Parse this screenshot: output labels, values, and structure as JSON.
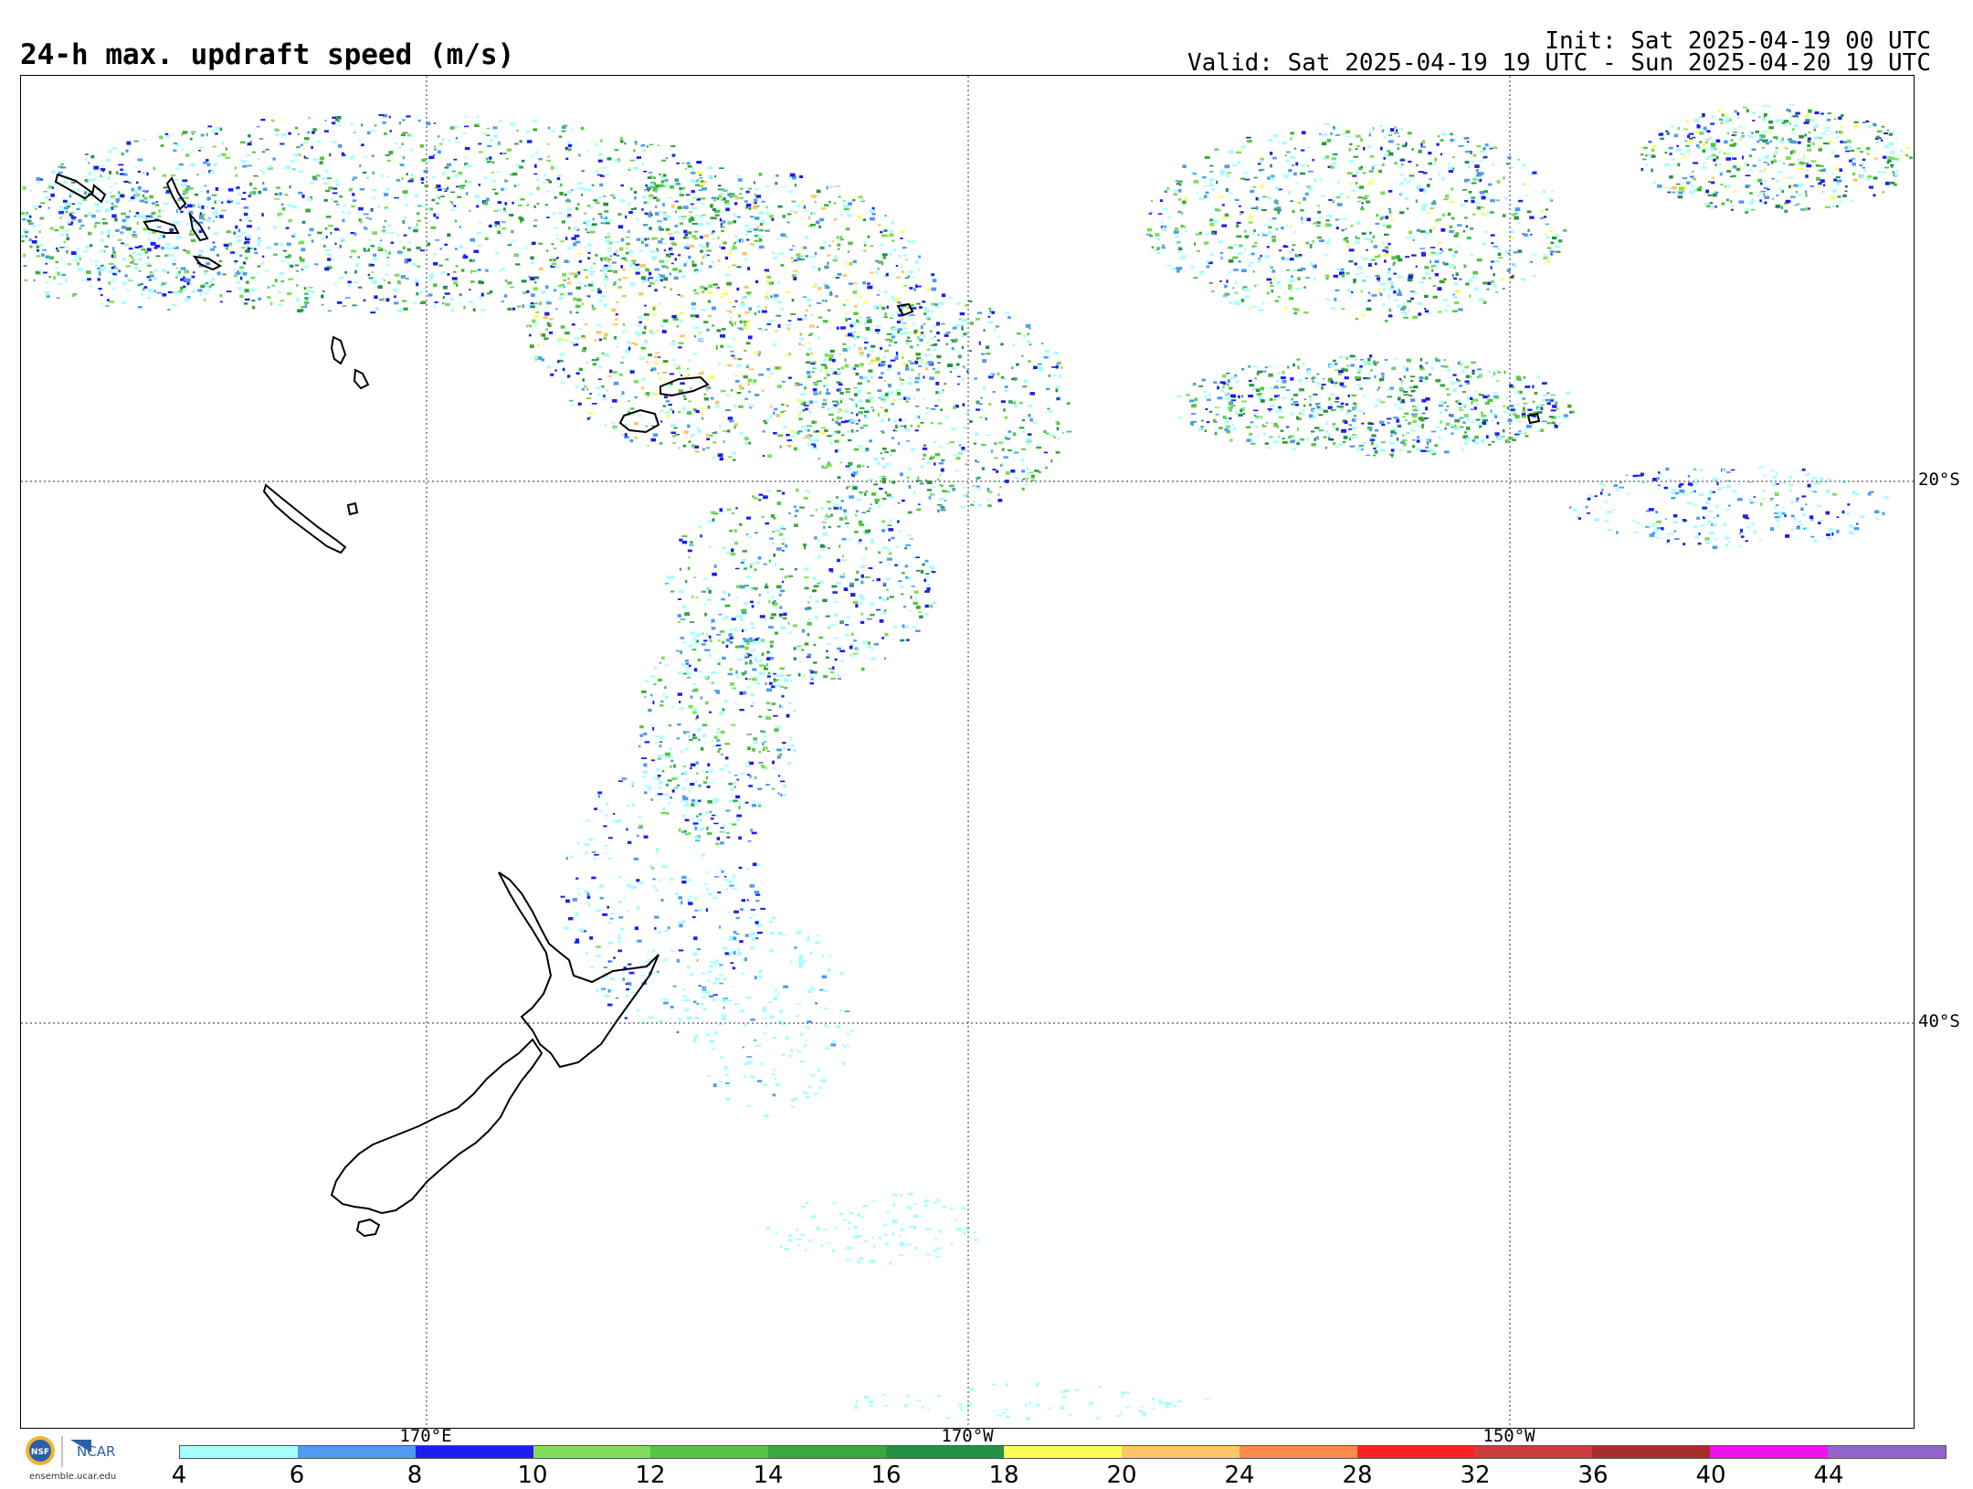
{
  "header": {
    "title": "24-h max. updraft speed (m/s)",
    "init": "Init: Sat 2025-04-19 00 UTC",
    "valid": "Valid: Sat 2025-04-19 19 UTC - Sun 2025-04-20 19 UTC"
  },
  "grid": {
    "lat_labels": [
      "20°S",
      "40°S"
    ],
    "lon_labels": [
      "170°E",
      "170°W",
      "150°W"
    ]
  },
  "map": {
    "field": "updraft speed",
    "landmasses": [
      "New Zealand North Island",
      "New Zealand South Island",
      "Stewart Island",
      "New Caledonia",
      "Vanuatu",
      "Fiji",
      "Tonga",
      "Solomon Islands"
    ]
  },
  "colorbar": {
    "ticks": [
      "4",
      "6",
      "8",
      "10",
      "12",
      "14",
      "16",
      "18",
      "20",
      "24",
      "28",
      "32",
      "36",
      "40",
      "44"
    ],
    "colors": [
      "#a6ffff",
      "#4d9cf2",
      "#1d1df2",
      "#7edc5a",
      "#54c544",
      "#38a83a",
      "#249245",
      "#fdfd5a",
      "#fec664",
      "#fd8a4a",
      "#fd2121",
      "#cc3c3c",
      "#a82c2c",
      "#ee12ee",
      "#9464cc"
    ]
  },
  "logo": {
    "org1": "NSF",
    "org2": "NCAR",
    "site": "ensemble.ucar.edu"
  }
}
